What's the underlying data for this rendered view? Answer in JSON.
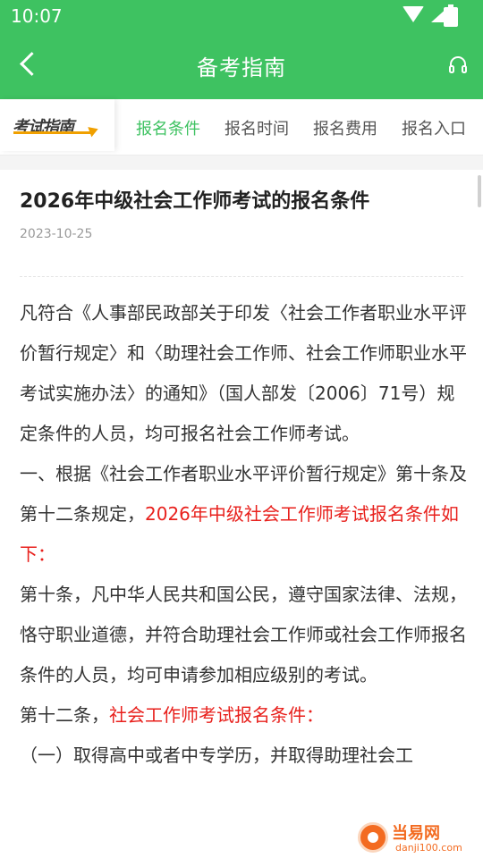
{
  "status_bar": {
    "time": "10:07"
  },
  "header": {
    "title": "备考指南"
  },
  "tabs": {
    "logo_text": "考试指南",
    "items": [
      {
        "label": "报名条件",
        "active": true
      },
      {
        "label": "报名时间",
        "active": false
      },
      {
        "label": "报名费用",
        "active": false
      },
      {
        "label": "报名入口",
        "active": false
      }
    ]
  },
  "article": {
    "title": "2026年中级社会工作师考试的报名条件",
    "date": "2023-10-25",
    "paragraphs": {
      "p1": "凡符合《人事部民政部关于印发〈社会工作者职业水平评价暂行规定〉和〈助理社会工作师、社会工作师职业水平考试实施办法〉的通知》（国人部发〔2006〕71号）规定条件的人员，均可报名社会工作师考试。",
      "p2_normal": "一、根据《社会工作者职业水平评价暂行规定》第十条及第十二条规定，",
      "p2_red": "2026年中级社会工作师考试报名条件如下：",
      "p3": "第十条，凡中华人民共和国公民，遵守国家法律、法规，恪守职业道德，并符合助理社会工作师或社会工作师报名条件的人员，均可申请参加相应级别的考试。",
      "p4_normal": "第十二条，",
      "p4_red": "社会工作师考试报名条件：",
      "p5": "（一）取得高中或者中专学历，并取得助理社会工"
    }
  },
  "watermark": {
    "text": "当易网",
    "url": "danji100.com"
  },
  "colors": {
    "accent": "#3ec261",
    "highlight": "#e8201c",
    "logo_underline": "#f0a000"
  }
}
